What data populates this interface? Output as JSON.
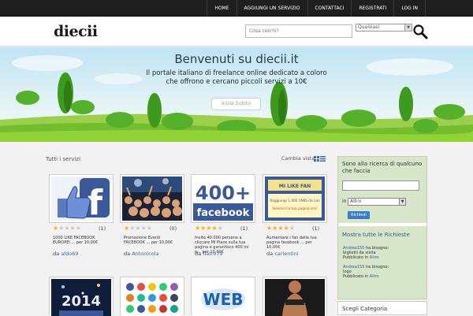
{
  "topnav": {
    "items": [
      {
        "label": "HOME"
      },
      {
        "label": "AGGIUNGI UN SERVIZIO"
      },
      {
        "label": "CONTATTACI"
      },
      {
        "label": "REGISTRATI"
      },
      {
        "label": "LOG IN"
      }
    ]
  },
  "header": {
    "logo": "diecii",
    "search_placeholder": "Cosa cerchi?",
    "category_selected": "Qualsiasi",
    "search_icon": "magnifier-icon"
  },
  "hero": {
    "title": "Benvenuti su diecii.it",
    "subtitle_line1": "Il portale italiano di freelance online dedicato a coloro",
    "subtitle_line2": "che offrono e cercano piccoli servizi a 10€",
    "button": "Inizia Subito"
  },
  "listing": {
    "title": "Tutti i servizi",
    "view_label": "Cambia vista",
    "by_prefix": "da",
    "cards": [
      {
        "rating": 1,
        "count": "(1)",
        "desc_line1": "1000 LIKE FACEBOOK",
        "desc_line2": "EUROPEI  ... per 10,00€",
        "user": "aldo69",
        "thumb": "facebook-like"
      },
      {
        "rating": 1,
        "count": "(0)",
        "desc_line1": "Promozione Eventi",
        "desc_line2": "FACEBOOK ... per 10,00€",
        "user": "Antonicola",
        "thumb": "crowd"
      },
      {
        "rating": 4,
        "count": "(1)",
        "desc_line1": "Invito 40.000 persone a",
        "desc_line2": "cliccare Mi Piace sulla tua",
        "desc_line3": "pagina e garantisco 400 mi p... per 10,00€",
        "user": "flatro79",
        "thumb": "400-facebook"
      },
      {
        "rating": 4,
        "count": "(1)",
        "desc_line1": "Aumentare i fan della tua",
        "desc_line2": "pagina facebook ... per",
        "desc_line3": "10,00€",
        "user": "carlentini",
        "thumb": "mi-piace-fan"
      }
    ],
    "thumb_texts": {
      "t3_big": "400+",
      "t3_small": "facebook",
      "t4_top": "MI LIKE FAN",
      "t4_mid": "Raggiungi 1.000 FANS da Lan",
      "t4_bot": "Inserisci la tua pagina ora!",
      "t5": "2014",
      "t7": "WEB"
    }
  },
  "sidebar": {
    "title": "Sono alla ricerca di qualcuno che faccia",
    "in_label": "in",
    "category_selected": "Altro",
    "button": "Richiedi",
    "show_all": "Mostra tutte le Richieste",
    "has_need": "ha bisogno:",
    "published_in": "Pubblicato in",
    "requests": [
      {
        "user": "Andrea155",
        "need": "biglietti da visita",
        "category": "Altro"
      },
      {
        "user": "Andrea155",
        "need": "logo",
        "category": "Altro"
      }
    ],
    "categories_title": "Scegli Categoria"
  },
  "colors": {
    "topbar": "#1f1f1f",
    "link": "#3a6fa6",
    "star": "#f2b01e",
    "sidebar": "#d7e6c8",
    "button": "#3a7bc8"
  }
}
